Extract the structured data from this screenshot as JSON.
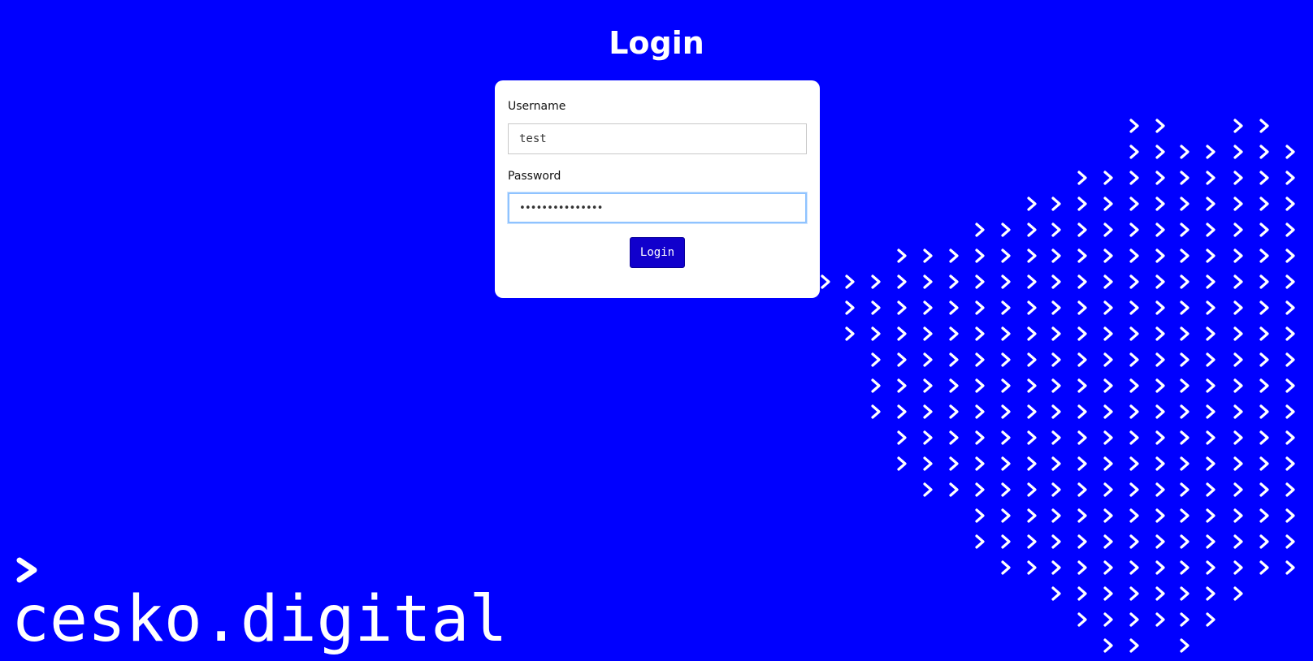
{
  "page": {
    "title": "Login"
  },
  "form": {
    "username_label": "Username",
    "username_value": "test",
    "password_label": "Password",
    "password_value": "•••••••••••••••",
    "submit_label": "Login"
  },
  "brand": {
    "name": "cesko.digital"
  },
  "colors": {
    "background": "#0000ff",
    "button": "#1100cc",
    "focus_ring": "#8fc3ff"
  }
}
